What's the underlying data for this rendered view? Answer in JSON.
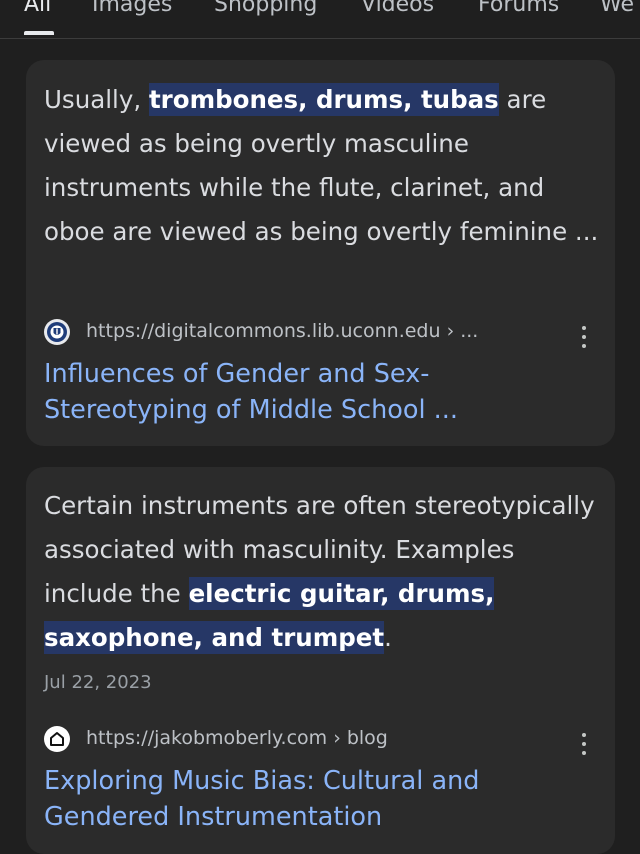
{
  "tabs": [
    {
      "label": "All",
      "active": true
    },
    {
      "label": "Images"
    },
    {
      "label": "Shopping"
    },
    {
      "label": "Videos"
    },
    {
      "label": "Forums"
    },
    {
      "label": "We"
    }
  ],
  "results": [
    {
      "snippet_before": "Usually, ",
      "snippet_highlight": "trombones, drums, tubas",
      "snippet_after": " are viewed as being overtly masculine instruments while the flute, clarinet, and oboe are viewed as being overtly feminine ...",
      "url": "https://digitalcommons.lib.uconn.edu › ...",
      "title": "Influences of Gender and Sex-Stereotyping of Middle School ..."
    },
    {
      "snippet_before": "Certain instruments are often stereotypically associated with masculinity. Examples include the ",
      "snippet_highlight": "electric guitar, drums, saxophone, and trumpet",
      "snippet_after": ".",
      "date": "Jul 22, 2023",
      "url": "https://jakobmoberly.com › blog",
      "title": "Exploring Music Bias: Cultural and Gendered Instrumentation"
    }
  ],
  "icons": {
    "result1_favicon": "university-seal-icon",
    "result2_favicon": "house-icon",
    "more": "more-vert-icon"
  },
  "colors": {
    "background": "#1f1f1f",
    "card": "#2b2b2b",
    "link": "#8ab4f8",
    "highlight_bg": "#263766"
  }
}
